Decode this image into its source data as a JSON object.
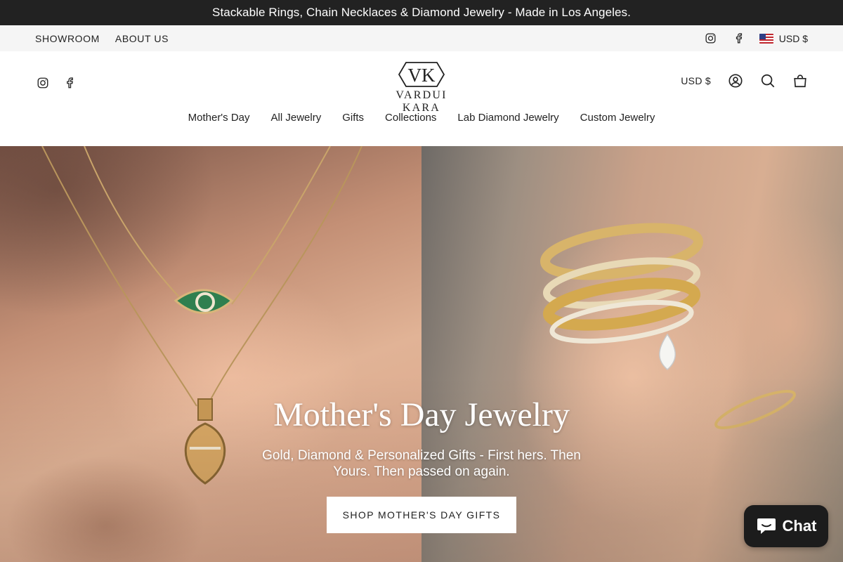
{
  "announcement": {
    "text": "Stackable Rings, Chain Necklaces & Diamond Jewelry - Made in Los Angeles."
  },
  "utility": {
    "links": [
      {
        "label": "SHOWROOM"
      },
      {
        "label": "ABOUT US"
      }
    ],
    "social": [
      "instagram-icon",
      "facebook-icon"
    ],
    "currency": "USD $"
  },
  "header": {
    "brand": {
      "monogram": "VK",
      "name": "VARDUI KARA"
    },
    "social": [
      "instagram-icon",
      "facebook-icon"
    ],
    "currency": "USD $",
    "icons": [
      "account-icon",
      "search-icon",
      "cart-icon"
    ]
  },
  "nav": {
    "items": [
      {
        "label": "Mother's Day"
      },
      {
        "label": "All Jewelry"
      },
      {
        "label": "Gifts"
      },
      {
        "label": "Collections"
      },
      {
        "label": "Lab Diamond Jewelry"
      },
      {
        "label": "Custom Jewelry"
      }
    ]
  },
  "hero": {
    "title": "Mother's Day Jewelry",
    "subtitle": "Gold, Diamond & Personalized Gifts - First hers. Then Yours. Then passed on again.",
    "cta": "SHOP MOTHER'S DAY GIFTS"
  },
  "chat": {
    "label": "Chat"
  },
  "colors": {
    "announcement_bg": "#222222",
    "utility_bg": "#f5f5f5",
    "chat_bg": "#1c1c1c",
    "text": "#222222"
  }
}
